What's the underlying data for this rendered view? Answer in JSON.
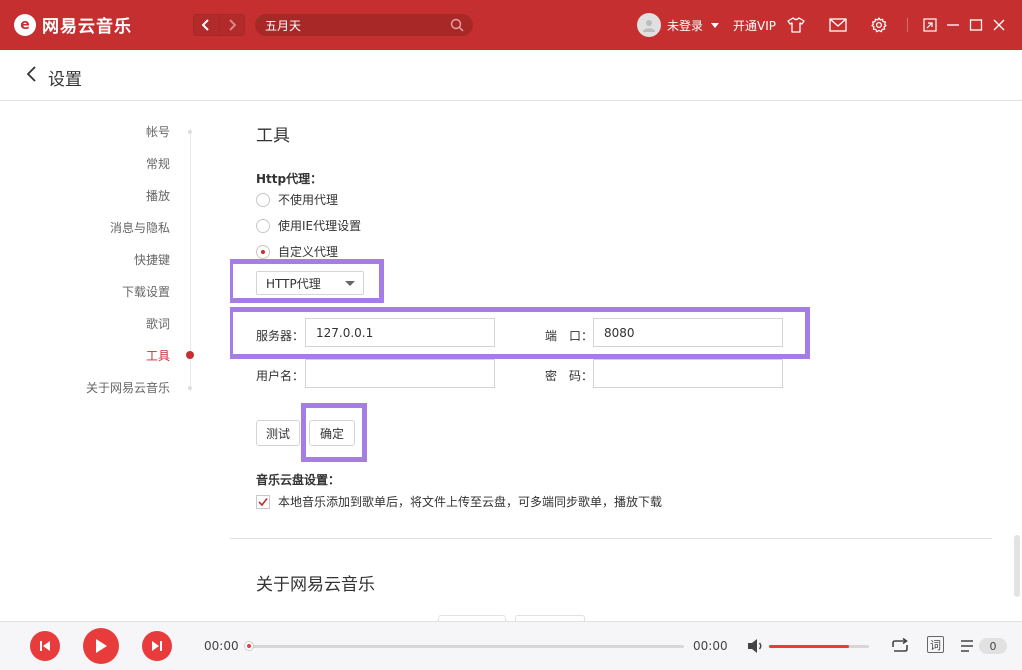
{
  "app": {
    "name": "网易云音乐",
    "logo_glyph": "e",
    "accent": "#c62f2f"
  },
  "titlebar": {
    "search_value": "五月天",
    "user_name": "未登录",
    "vip_label": "开通VIP"
  },
  "settings": {
    "title": "设置"
  },
  "sidebar": {
    "items": [
      {
        "label": "帐号",
        "active": false
      },
      {
        "label": "常规",
        "active": false
      },
      {
        "label": "播放",
        "active": false
      },
      {
        "label": "消息与隐私",
        "active": false
      },
      {
        "label": "快捷键",
        "active": false
      },
      {
        "label": "下载设置",
        "active": false
      },
      {
        "label": "歌词",
        "active": false
      },
      {
        "label": "工具",
        "active": true
      },
      {
        "label": "关于网易云音乐",
        "active": false
      }
    ]
  },
  "tools": {
    "title": "工具",
    "http_proxy_label": "Http代理：",
    "proxy_options": [
      {
        "label": "不使用代理",
        "checked": false
      },
      {
        "label": "使用IE代理设置",
        "checked": false
      },
      {
        "label": "自定义代理",
        "checked": true
      }
    ],
    "proxy_type": "HTTP代理",
    "server_label": "服务器：",
    "server_value": "127.0.0.1",
    "port_label": "端　口：",
    "port_value": "8080",
    "username_label": "用户名：",
    "username_value": "",
    "password_label": "密　码：",
    "password_value": "",
    "test_button": "测试",
    "confirm_button": "确定",
    "cloud_label": "音乐云盘设置：",
    "cloud_option": "本地音乐添加到歌单后，将文件上传至云盘，可多端同步歌单，播放下载",
    "cloud_checked": true
  },
  "about": {
    "title": "关于网易云音乐"
  },
  "player": {
    "current_time": "00:00",
    "total_time": "00:00",
    "progress": 0,
    "volume": 0.8,
    "lyric_label": "词",
    "playlist_count": "0"
  },
  "highlight_color": "#a67de6"
}
